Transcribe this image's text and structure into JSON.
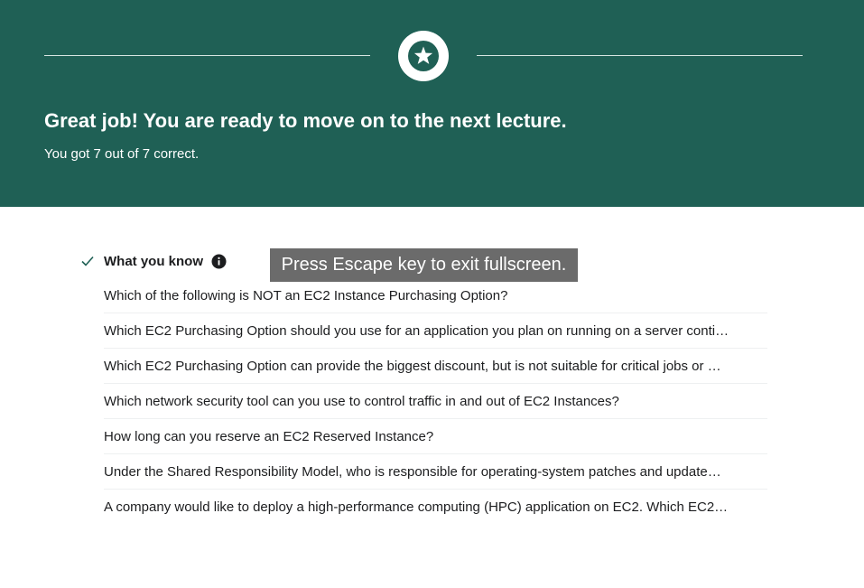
{
  "banner": {
    "headline": "Great job! You are ready to move on to the next lecture.",
    "score_text": "You got 7 out of 7 correct.",
    "badge_icon": "star-icon",
    "background_color": "#1f6055"
  },
  "section": {
    "title": "What you know",
    "status_icon": "check-icon",
    "info_icon": "info-icon"
  },
  "questions": [
    "Which of the following is NOT an EC2 Instance Purchasing Option?",
    "Which EC2 Purchasing Option should you use for an application you plan on running on a server conti…",
    "Which EC2 Purchasing Option can provide the biggest discount, but is not suitable for critical jobs or …",
    "Which network security tool can you use to control traffic in and out of EC2 Instances?",
    "How long can you reserve an EC2 Reserved Instance?",
    "Under the Shared Responsibility Model, who is responsible for operating-system patches and update…",
    "A company would like to deploy a high-performance computing (HPC) application on EC2. Which EC2…"
  ],
  "fullscreen_notice": "Press Escape key to exit fullscreen."
}
